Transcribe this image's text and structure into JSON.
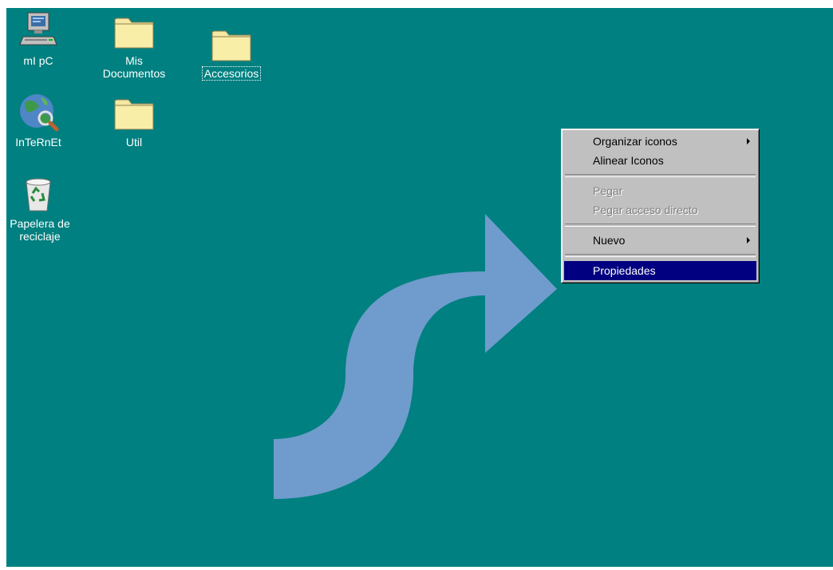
{
  "desktop": {
    "background_color": "#008080",
    "icons": [
      {
        "label": "mI pC",
        "icon": "computer-icon"
      },
      {
        "label": "Mis Documentos",
        "icon": "folder-icon"
      },
      {
        "label": "Accesorios",
        "icon": "folder-icon",
        "selected": true
      },
      {
        "label": "InTeRnEt",
        "icon": "internet-globe-icon"
      },
      {
        "label": "Util",
        "icon": "folder-icon"
      },
      {
        "label": "Papelera de reciclaje",
        "icon": "recycle-bin-icon"
      }
    ]
  },
  "context_menu": {
    "items": [
      {
        "label": "Organizar iconos",
        "submenu": true,
        "enabled": true
      },
      {
        "label": "Alinear Iconos",
        "enabled": true
      },
      {
        "label": "Pegar",
        "enabled": false
      },
      {
        "label": "Pegar acceso directo",
        "enabled": false
      },
      {
        "label": "Nuevo",
        "submenu": true,
        "enabled": true
      },
      {
        "label": "Propiedades",
        "enabled": true,
        "highlighted": true
      }
    ],
    "highlight_color": "#000080"
  },
  "annotation": {
    "arrow_color": "#6f9ccc",
    "icon": "curved-arrow-icon"
  }
}
